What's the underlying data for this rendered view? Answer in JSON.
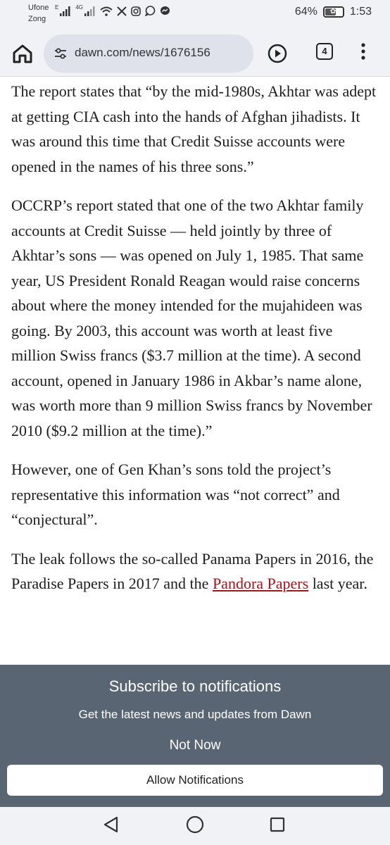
{
  "status_bar": {
    "carrier_1": "Ufone",
    "carrier_2": "Zong",
    "net_1": "E",
    "net_2": "4G",
    "battery": "64%",
    "battery_level": 0.64,
    "time": "1:53",
    "icons": [
      "signal-icon",
      "signal-icon",
      "wifi-icon",
      "x-icon",
      "instagram-icon",
      "whatsapp-icon",
      "messenger-icon"
    ]
  },
  "browser": {
    "url": "dawn.com/news/1676156",
    "tab_count": "4"
  },
  "article": {
    "paragraphs": [
      "The report states that “by the mid-1980s, Akhtar was adept at getting CIA cash into the hands of Afghan jihadists. It was around this time that Credit Suisse accounts were opened in the names of his three sons.”",
      "OCCRP’s report stated that one of the two Akhtar family accounts at Credit Suisse — held jointly by three of Akhtar’s sons — was opened on July 1, 1985. That same year, US President Ronald Reagan would raise concerns about where the money intended for the mujahideen was going. By 2003, this account was worth at least five million Swiss francs ($3.7 million at the time). A second account, opened in January 1986 in Akbar’s name alone, was worth more than 9 million Swiss francs by November 2010 ($9.2 million at the time).”",
      "However, one of Gen Khan’s sons told the project’s representative this information was “not correct” and “conjectural”."
    ],
    "last_paragraph": {
      "text_before": "The leak follows the so-called Panama Papers in 2016, the Paradise Papers in 2017 and the ",
      "link": "Pandora Papers",
      "text_after": " last year."
    },
    "link_color": "#a4141b"
  },
  "notification": {
    "title": "Subscribe to notifications",
    "subtitle": "Get the latest news and updates from Dawn",
    "dismiss_label": "Not Now",
    "allow_label": "Allow Notifications",
    "background": "#5a6574"
  }
}
